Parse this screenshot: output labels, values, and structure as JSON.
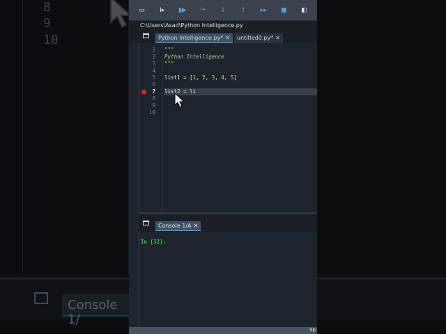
{
  "background": {
    "line_numbers": [
      "8",
      "9",
      "10"
    ],
    "console_tab": "Console 1/"
  },
  "toolbar": {
    "icons": [
      "maximize-pane-icon",
      "run-cell-icon",
      "continue-icon",
      "step-over-icon",
      "step-into-icon",
      "step-out-icon",
      "fast-forward-icon",
      "stop-icon",
      "layout-icon"
    ]
  },
  "path": "C:\\Users\\Asad\\Python Intelligence.py",
  "tabs": [
    {
      "label": "Python Intelligence.py*",
      "close": "✕"
    },
    {
      "label": "untitled0.py*",
      "close": "✕"
    }
  ],
  "editor": {
    "line_numbers": [
      "1",
      "2",
      "3",
      "4",
      "5",
      "6",
      "7",
      "8",
      "9",
      "10"
    ],
    "lines": {
      "l1": "\"\"\"",
      "l2": "Python Intelligence",
      "l3": "\"\"\"",
      "l5a": "list1 = [",
      "n1": "1",
      "n2": "2",
      "n3": "3",
      "n4": "4",
      "n5": "5",
      "l7": "list2 = li"
    },
    "current_line": 7,
    "breakpoint_line": 7
  },
  "console": {
    "tab": "Console 1/A",
    "close": "✕",
    "prompt": "In [32]:"
  },
  "status": {
    "text": "Sp"
  }
}
